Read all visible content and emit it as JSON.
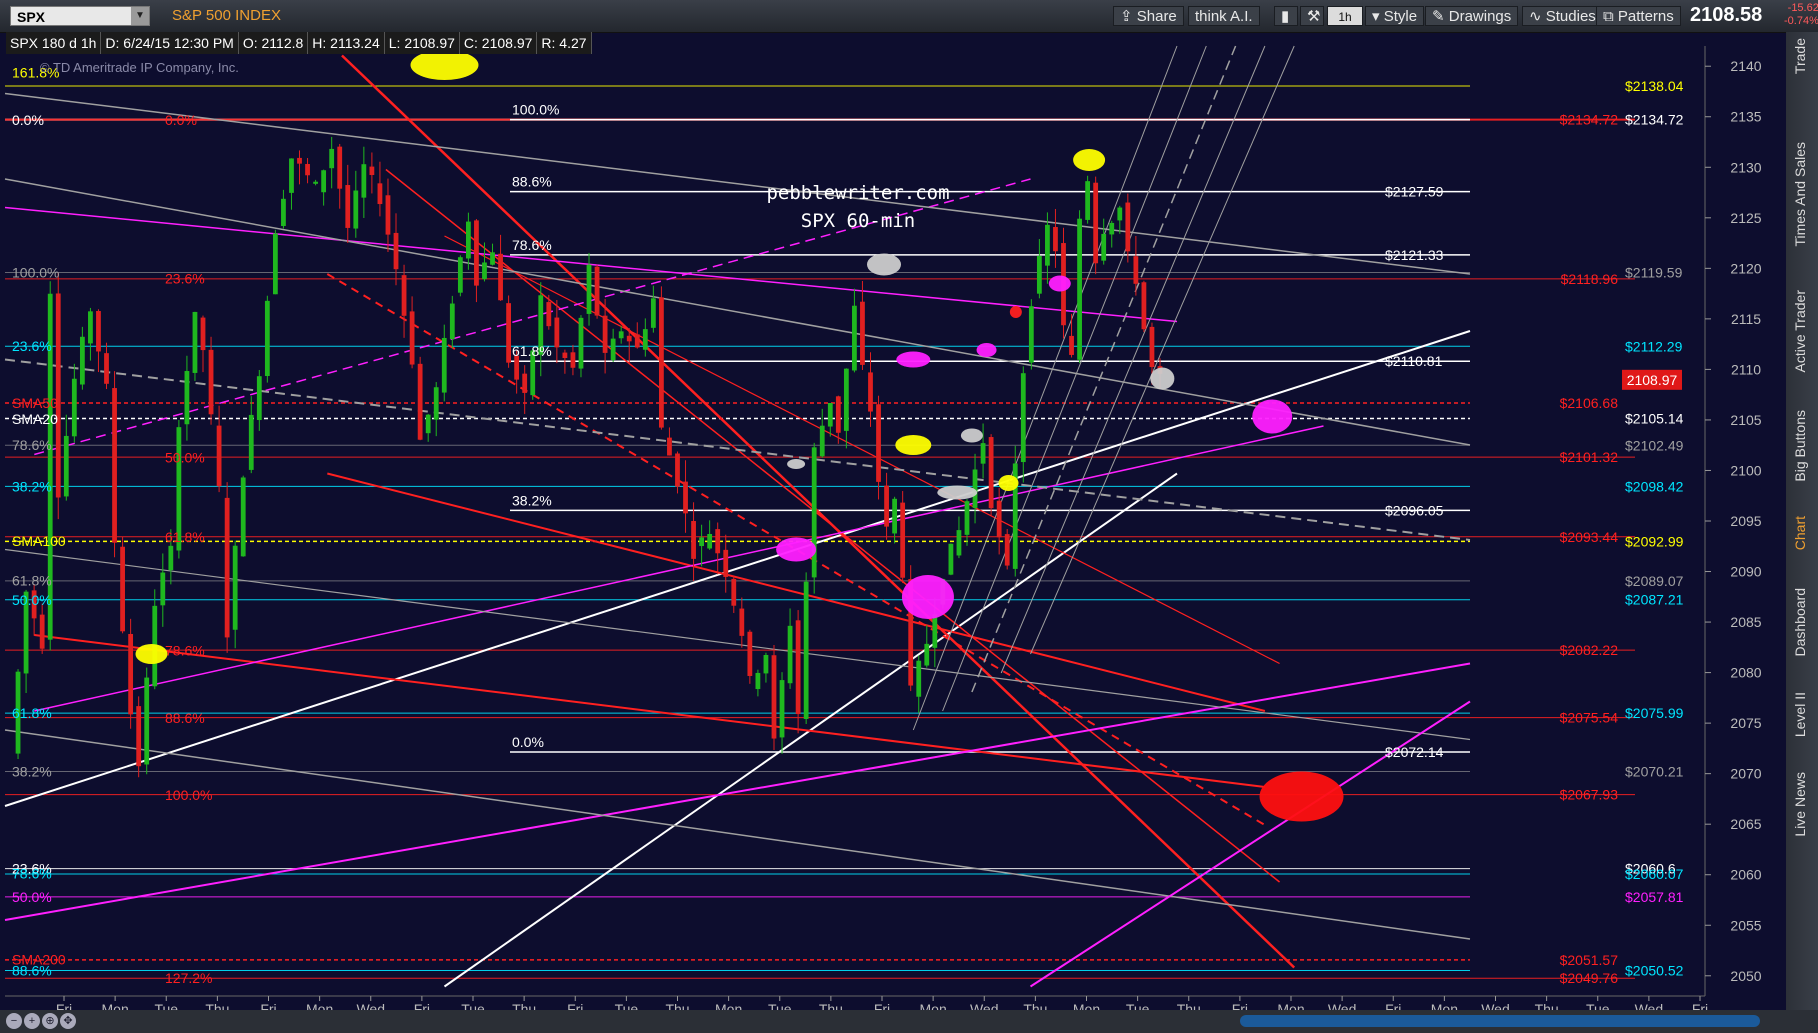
{
  "header": {
    "symbol": "SPX",
    "security_name": "S&P 500 INDEX",
    "buttons": [
      "Share",
      "think A.I.",
      "1h",
      "Style",
      "Drawings",
      "Studies",
      "Patterns"
    ],
    "last_price": "2108.58",
    "change": "-15.62",
    "change_pct": "-0.74%"
  },
  "info": {
    "title": "SPX 180 d 1h",
    "date": "D: 6/24/15 12:30 PM",
    "open": "O: 2112.8",
    "high": "H: 2113.24",
    "low": "L: 2108.97",
    "close": "C: 2108.97",
    "range": "R: 4.27",
    "copyright": "© TD Ameritrade IP Company, Inc."
  },
  "side_tabs": [
    "Trade",
    "Times And Sales",
    "Active Trader",
    "Big Buttons",
    "Chart",
    "Dashboard",
    "Level II",
    "Live News"
  ],
  "colors": {
    "background": "#0d0d2e",
    "candle_up": "#1fb81f",
    "candle_down": "#e02020",
    "fib_red": "#ff2020",
    "magenta": "#ff20ff",
    "yellow": "#ffff00",
    "cyan": "#00ffff"
  },
  "chart_data": {
    "type": "candlestick",
    "watermark": [
      "pebblewriter.com",
      "SPX 60-min"
    ],
    "ylim": [
      2048,
      2142
    ],
    "y_ticks": [
      2050,
      2055,
      2060,
      2065,
      2070,
      2075,
      2080,
      2085,
      2090,
      2095,
      2100,
      2105,
      2110,
      2115,
      2120,
      2125,
      2130,
      2135,
      2140
    ],
    "x_labels": [
      "Fri",
      "Mon",
      "Tue",
      "Thu",
      "Fri",
      "Mon",
      "Wed",
      "Fri",
      "Tue",
      "Thu",
      "Fri",
      "Tue",
      "Thu",
      "Mon",
      "Tue",
      "Thu",
      "Fri",
      "Mon",
      "Wed",
      "Thu",
      "Mon",
      "Tue",
      "Thu",
      "Fri",
      "Mon",
      "Wed",
      "Fri",
      "Mon",
      "Wed",
      "Thu",
      "Tue",
      "Wed",
      "Fri"
    ],
    "current_price": "2108.97",
    "price_path": [
      [
        0,
        2072
      ],
      [
        2,
        2088
      ],
      [
        4,
        2083
      ],
      [
        5,
        2118
      ],
      [
        6,
        2098
      ],
      [
        8,
        2109
      ],
      [
        10,
        2116
      ],
      [
        12,
        2108
      ],
      [
        13,
        2093
      ],
      [
        15,
        2076
      ],
      [
        16,
        2071
      ],
      [
        18,
        2087
      ],
      [
        20,
        2092
      ],
      [
        21,
        2105
      ],
      [
        23,
        2115
      ],
      [
        24,
        2112
      ],
      [
        26,
        2098
      ],
      [
        27,
        2084
      ],
      [
        29,
        2100
      ],
      [
        31,
        2110
      ],
      [
        33,
        2124
      ],
      [
        35,
        2131
      ],
      [
        38,
        2128
      ],
      [
        40,
        2132
      ],
      [
        42,
        2124
      ],
      [
        44,
        2130
      ],
      [
        46,
        2127
      ],
      [
        48,
        2120
      ],
      [
        50,
        2111
      ],
      [
        51,
        2103
      ],
      [
        53,
        2108
      ],
      [
        55,
        2117
      ],
      [
        57,
        2125
      ],
      [
        58,
        2119
      ],
      [
        60,
        2122
      ],
      [
        62,
        2111
      ],
      [
        64,
        2107
      ],
      [
        66,
        2117
      ],
      [
        68,
        2112
      ],
      [
        70,
        2110
      ],
      [
        72,
        2120
      ],
      [
        74,
        2111
      ],
      [
        76,
        2114
      ],
      [
        78,
        2112
      ],
      [
        80,
        2117
      ],
      [
        81,
        2104
      ],
      [
        83,
        2099
      ],
      [
        85,
        2092
      ],
      [
        87,
        2094
      ],
      [
        89,
        2090
      ],
      [
        91,
        2084
      ],
      [
        92,
        2079
      ],
      [
        94,
        2082
      ],
      [
        95,
        2073
      ],
      [
        97,
        2085
      ],
      [
        98,
        2076
      ],
      [
        100,
        2102
      ],
      [
        102,
        2107
      ],
      [
        103,
        2104
      ],
      [
        105,
        2116
      ],
      [
        106,
        2110
      ],
      [
        107,
        2106
      ],
      [
        108,
        2099
      ],
      [
        109,
        2094
      ],
      [
        110,
        2097
      ],
      [
        111,
        2090
      ],
      [
        112,
        2078
      ],
      [
        114,
        2083
      ],
      [
        116,
        2090
      ],
      [
        118,
        2094
      ],
      [
        120,
        2100
      ],
      [
        121,
        2103
      ],
      [
        122,
        2097
      ],
      [
        123,
        2093
      ],
      [
        124,
        2090
      ],
      [
        125,
        2101
      ],
      [
        126,
        2110
      ],
      [
        127,
        2117
      ],
      [
        129,
        2124
      ],
      [
        130,
        2122
      ],
      [
        131,
        2114
      ],
      [
        132,
        2111
      ],
      [
        133,
        2125
      ],
      [
        134,
        2129
      ],
      [
        135,
        2121
      ],
      [
        136,
        2124
      ],
      [
        138,
        2126
      ],
      [
        139,
        2121
      ],
      [
        140,
        2119
      ],
      [
        141,
        2114
      ],
      [
        142,
        2110
      ],
      [
        143,
        2109
      ]
    ],
    "levels": [
      {
        "price": 2138.04,
        "label": "$2138.04",
        "color": "yellow"
      },
      {
        "price": 2134.72,
        "label": "$2134.72",
        "color": "white"
      },
      {
        "price": 2134.72,
        "label": "$2134.72",
        "color": "red"
      },
      {
        "price": 2127.59,
        "label": "$2127.59",
        "color": "white"
      },
      {
        "price": 2121.33,
        "label": "$2121.33",
        "color": "white"
      },
      {
        "price": 2119.59,
        "label": "$2119.59",
        "color": "gray"
      },
      {
        "price": 2118.96,
        "label": "$2118.96",
        "color": "red"
      },
      {
        "price": 2112.29,
        "label": "$2112.29",
        "color": "cyan"
      },
      {
        "price": 2110.81,
        "label": "$2110.81",
        "color": "white"
      },
      {
        "price": 2106.68,
        "label": "$2106.68",
        "color": "red"
      },
      {
        "price": 2105.14,
        "label": "$2105.14",
        "color": "white"
      },
      {
        "price": 2102.49,
        "label": "$2102.49",
        "color": "gray"
      },
      {
        "price": 2101.32,
        "label": "$2101.32",
        "color": "red"
      },
      {
        "price": 2098.42,
        "label": "$2098.42",
        "color": "cyan"
      },
      {
        "price": 2096.05,
        "label": "$2096.05",
        "color": "white"
      },
      {
        "price": 2093.44,
        "label": "$2093.44",
        "color": "red"
      },
      {
        "price": 2092.99,
        "label": "$2092.99",
        "color": "yellow"
      },
      {
        "price": 2089.07,
        "label": "$2089.07",
        "color": "gray"
      },
      {
        "price": 2087.21,
        "label": "$2087.21",
        "color": "cyan"
      },
      {
        "price": 2082.22,
        "label": "$2082.22",
        "color": "red"
      },
      {
        "price": 2075.99,
        "label": "$2075.99",
        "color": "cyan"
      },
      {
        "price": 2075.54,
        "label": "$2075.54",
        "color": "red"
      },
      {
        "price": 2072.14,
        "label": "$2072.14",
        "color": "white"
      },
      {
        "price": 2070.21,
        "label": "$2070.21",
        "color": "gray"
      },
      {
        "price": 2067.93,
        "label": "$2067.93",
        "color": "red"
      },
      {
        "price": 2060.6,
        "label": "$2060.6",
        "color": "white"
      },
      {
        "price": 2060.07,
        "label": "$2060.07",
        "color": "cyan"
      },
      {
        "price": 2057.81,
        "label": "$2057.81",
        "color": "magenta"
      },
      {
        "price": 2051.57,
        "label": "$2051.57",
        "color": "red"
      },
      {
        "price": 2050.52,
        "label": "$2050.52",
        "color": "cyan"
      },
      {
        "price": 2049.76,
        "label": "$2049.76",
        "color": "red"
      }
    ],
    "left_labels": [
      {
        "price": 2139.4,
        "text": "161.8%",
        "color": "yellow"
      },
      {
        "price": 2134.7,
        "text": "0.0%",
        "color": "white"
      },
      {
        "price": 2134.7,
        "text": "0.0%",
        "color": "red"
      },
      {
        "price": 2119.6,
        "text": "100.0%",
        "color": "gray"
      },
      {
        "price": 2119.0,
        "text": "23.6%",
        "color": "red"
      },
      {
        "price": 2112.3,
        "text": "23.6%",
        "color": "cyan"
      },
      {
        "price": 2106.7,
        "text": "SMA50",
        "color": "red"
      },
      {
        "price": 2105.1,
        "text": "SMA20",
        "color": "white"
      },
      {
        "price": 2102.5,
        "text": "78.6%",
        "color": "gray"
      },
      {
        "price": 2101.3,
        "text": "50.0%",
        "color": "red"
      },
      {
        "price": 2098.4,
        "text": "38.2%",
        "color": "cyan"
      },
      {
        "price": 2093.4,
        "text": "61.8%",
        "color": "red"
      },
      {
        "price": 2093.0,
        "text": "SMA100",
        "color": "yellow"
      },
      {
        "price": 2089.1,
        "text": "61.8%",
        "color": "gray"
      },
      {
        "price": 2087.2,
        "text": "50.0%",
        "color": "cyan"
      },
      {
        "price": 2082.2,
        "text": "78.6%",
        "color": "red"
      },
      {
        "price": 2076.0,
        "text": "61.8%",
        "color": "cyan"
      },
      {
        "price": 2075.5,
        "text": "88.6%",
        "color": "red"
      },
      {
        "price": 2070.2,
        "text": "38.2%",
        "color": "gray"
      },
      {
        "price": 2067.9,
        "text": "100.0%",
        "color": "red"
      },
      {
        "price": 2060.6,
        "text": "23.6%",
        "color": "white"
      },
      {
        "price": 2060.1,
        "text": "78.6%",
        "color": "cyan"
      },
      {
        "price": 2057.8,
        "text": "50.0%",
        "color": "magenta"
      },
      {
        "price": 2051.6,
        "text": "SMA200",
        "color": "red"
      },
      {
        "price": 2050.5,
        "text": "88.6%",
        "color": "cyan"
      },
      {
        "price": 2049.8,
        "text": "127.2%",
        "color": "red"
      }
    ],
    "fib_retracement": [
      {
        "price": 2134.72,
        "text": "100.0%"
      },
      {
        "price": 2127.59,
        "text": "88.6%"
      },
      {
        "price": 2121.33,
        "text": "78.6%"
      },
      {
        "price": 2110.81,
        "text": "61.8%"
      },
      {
        "price": 2096.05,
        "text": "38.2%"
      },
      {
        "price": 2072.14,
        "text": "0.0%"
      }
    ]
  }
}
